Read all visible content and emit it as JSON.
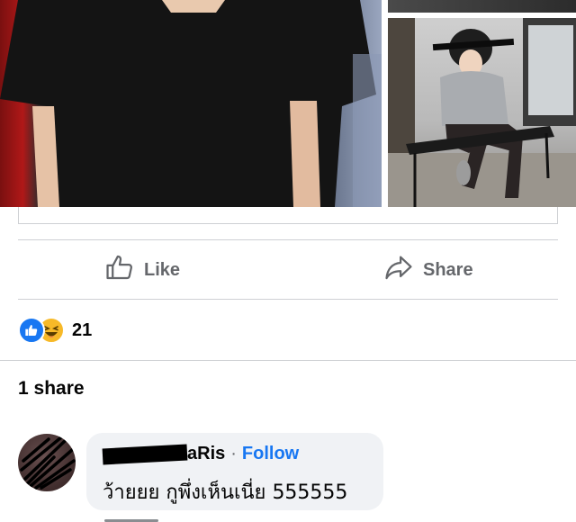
{
  "actions": {
    "like_label": "Like",
    "share_label": "Share"
  },
  "reactions": {
    "icons": [
      "like-icon",
      "haha-icon"
    ],
    "count": "21"
  },
  "shares": {
    "label": "1 share"
  },
  "comment": {
    "author_visible": "aRis",
    "separator": "·",
    "follow_label": "Follow",
    "text": "ว้ายยย กูพึ่งเห็นเนี่ย 555555"
  },
  "colors": {
    "accent": "#1877f2",
    "muted": "#65676b",
    "bubble": "#f0f2f5",
    "divider": "#ced0d4"
  }
}
